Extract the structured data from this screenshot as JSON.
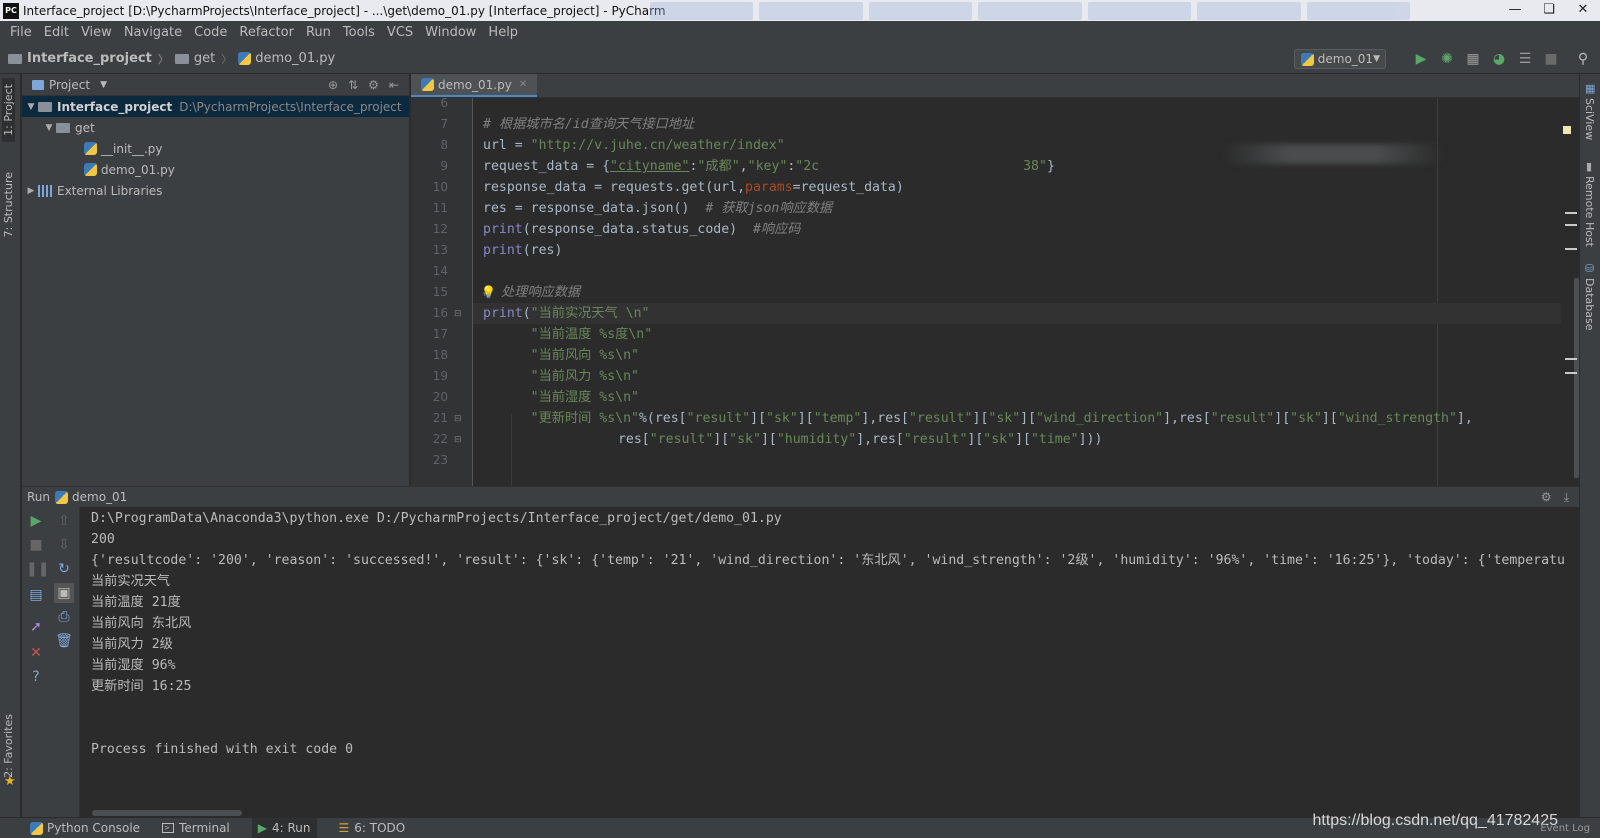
{
  "window": {
    "title": "Interface_project [D:\\PycharmProjects\\Interface_project] - ...\\get\\demo_01.py [Interface_project] - PyCharm",
    "logo": "PC"
  },
  "menu": [
    "File",
    "Edit",
    "View",
    "Navigate",
    "Code",
    "Refactor",
    "Run",
    "Tools",
    "VCS",
    "Window",
    "Help"
  ],
  "breadcrumb": [
    "Interface_project",
    "get",
    "demo_01.py"
  ],
  "run_config": "demo_01",
  "left_stripe": {
    "project": "1: Project",
    "structure": "7: Structure",
    "favorites": "2: Favorites"
  },
  "right_stripe": {
    "sciview": "SciView",
    "remote_host": "Remote Host",
    "database": "Database"
  },
  "project_panel": {
    "header": "Project",
    "tree": [
      {
        "name": "Interface_project",
        "path": "D:\\PycharmProjects\\Interface_project"
      },
      {
        "name": "get"
      },
      {
        "name": "__init__.py"
      },
      {
        "name": "demo_01.py"
      },
      {
        "name": "External Libraries"
      }
    ]
  },
  "editor": {
    "tab": "demo_01.py",
    "line_numbers": [
      "6",
      "7",
      "8",
      "9",
      "10",
      "11",
      "12",
      "13",
      "14",
      "15",
      "16",
      "17",
      "18",
      "19",
      "20",
      "21",
      "22",
      "23"
    ],
    "code": {
      "l7": "# 根据城市名/id查询天气接口地址",
      "l8a": "url = ",
      "l8b": "\"http://v.juhe.cn/weather/index\"",
      "l9a": "request_data = {",
      "l9b": "\"cityname\"",
      "l9c": ":",
      "l9d": "\"成都\"",
      "l9e": ",",
      "l9f": "\"key\"",
      "l9g": ":",
      "l9h": "\"2c",
      "l9i": "38\"",
      "l9j": "}",
      "l10a": "response_data = requests.get(url,",
      "l10b": "params",
      "l10c": "=request_data)",
      "l11a": "res = response_data.json()  ",
      "l11b": "# 获取json响应数据",
      "l12a": "print",
      "l12b": "(response_data.status_code)  ",
      "l12c": "#响应码",
      "l13a": "print",
      "l13b": "(res)",
      "l15a": "#",
      "l15b": "处理响应数据",
      "l16a": "print",
      "l16b": "(",
      "l16c": "\"当前实况天气 \\n\"",
      "l17": "\"当前温度 %s度\\n\"",
      "l18": "\"当前风向 %s\\n\"",
      "l19": "\"当前风力 %s\\n\"",
      "l20": "\"当前湿度 %s\\n\"",
      "l21a": "\"更新时间 %s\\n\"",
      "l21b": "%(res[",
      "l21c": "\"result\"",
      "l21d": "][",
      "l21e": "\"sk\"",
      "l21f": "][",
      "l21g": "\"temp\"",
      "l21h": "],res[",
      "l21i": "\"result\"",
      "l21j": "][",
      "l21k": "\"sk\"",
      "l21l": "][",
      "l21m": "\"wind_direction\"",
      "l21n": "],res[",
      "l21o": "\"result\"",
      "l21p": "][",
      "l21q": "\"sk\"",
      "l21r": "][",
      "l21s": "\"wind_strength\"",
      "l21t": "],",
      "l22a": "res[",
      "l22b": "\"result\"",
      "l22c": "][",
      "l22d": "\"sk\"",
      "l22e": "][",
      "l22f": "\"humidity\"",
      "l22g": "],res[",
      "l22h": "\"result\"",
      "l22i": "][",
      "l22j": "\"sk\"",
      "l22k": "][",
      "l22l": "\"time\"",
      "l22m": "]))"
    }
  },
  "run_panel": {
    "label": "Run",
    "config": "demo_01",
    "output": [
      "D:\\ProgramData\\Anaconda3\\python.exe D:/PycharmProjects/Interface_project/get/demo_01.py",
      "200",
      "{'resultcode': '200', 'reason': 'successed!', 'result': {'sk': {'temp': '21', 'wind_direction': '东北风', 'wind_strength': '2级', 'humidity': '96%', 'time': '16:25'}, 'today': {'temperatu",
      "当前实况天气",
      "当前温度 21度",
      "当前风向 东北风",
      "当前风力 2级",
      "当前湿度 96%",
      "更新时间 16:25",
      "Process finished with exit code 0"
    ]
  },
  "statusbar": {
    "python_console": "Python Console",
    "terminal": "Terminal",
    "run": "4: Run",
    "todo": "6: TODO",
    "event_log": "Event Log"
  },
  "watermark": "https://blog.csdn.net/qq_41782425",
  "colors": {
    "editor_bg": "#2b2b2b",
    "panel_bg": "#3c3f41",
    "string": "#6a8759",
    "comment": "#808080",
    "builtin": "#8888c6",
    "param": "#aa4926",
    "run_green": "#59a869",
    "error_red": "#c75450"
  }
}
